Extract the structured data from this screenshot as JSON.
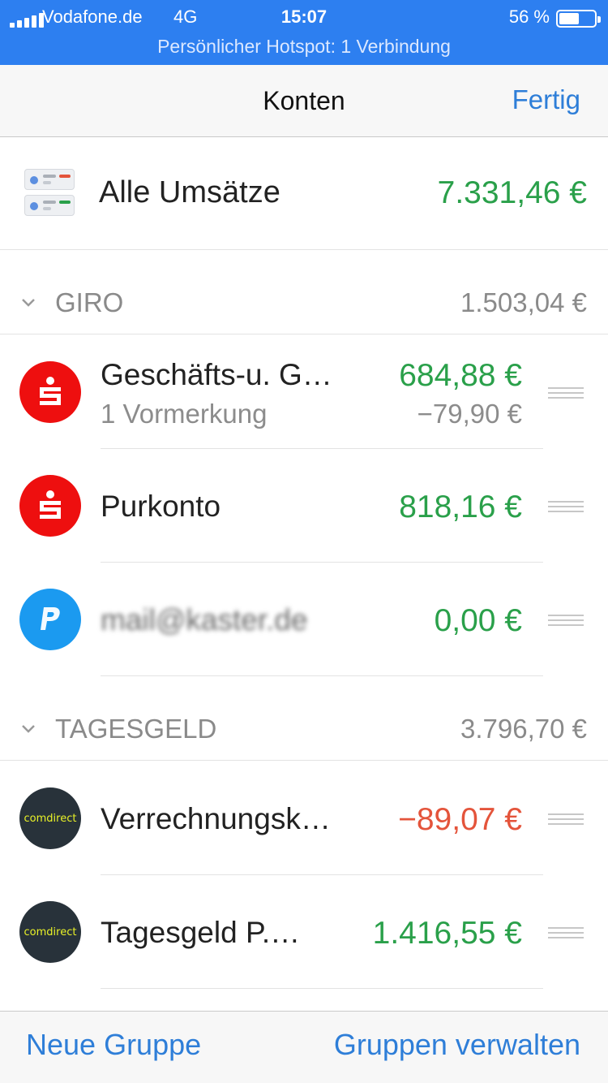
{
  "status_bar": {
    "carrier": "Vodafone.de",
    "network": "4G",
    "time": "15:07",
    "battery": "56 %",
    "hotspot": "Persönlicher Hotspot: 1 Verbindung"
  },
  "nav": {
    "title": "Konten",
    "done_label": "Fertig"
  },
  "all_transactions": {
    "label": "Alle Umsätze",
    "amount": "7.331,46 €"
  },
  "groups": [
    {
      "name": "GIRO",
      "total": "1.503,04 €",
      "accounts": [
        {
          "name": "Geschäfts-u. G…",
          "amount": "684,88 €",
          "sub": "1 Vormerkung",
          "pending": "−79,90 €",
          "logo": "sparkasse-icon"
        },
        {
          "name": "Purkonto",
          "amount": "818,16 €",
          "logo": "sparkasse-icon"
        },
        {
          "name": "mail@kaster.de",
          "amount": "0,00 €",
          "logo": "paypal-icon"
        }
      ]
    },
    {
      "name": "TAGESGELD",
      "total": "3.796,70 €",
      "accounts": [
        {
          "name": "Verrechnungsk…",
          "amount": "−89,07 €",
          "logo": "comdirect-icon",
          "logo_text": "comdirect"
        },
        {
          "name": "Tagesgeld P.…",
          "amount": "1.416,55 €",
          "logo": "comdirect-icon",
          "logo_text": "comdirect"
        }
      ]
    }
  ],
  "toolbar": {
    "new_group": "Neue Gruppe",
    "manage_groups": "Gruppen verwalten"
  },
  "colors": {
    "accent": "#2e7ed8",
    "positive": "#2aa04a",
    "negative": "#e4543b",
    "status_bar": "#2d7ff0"
  }
}
